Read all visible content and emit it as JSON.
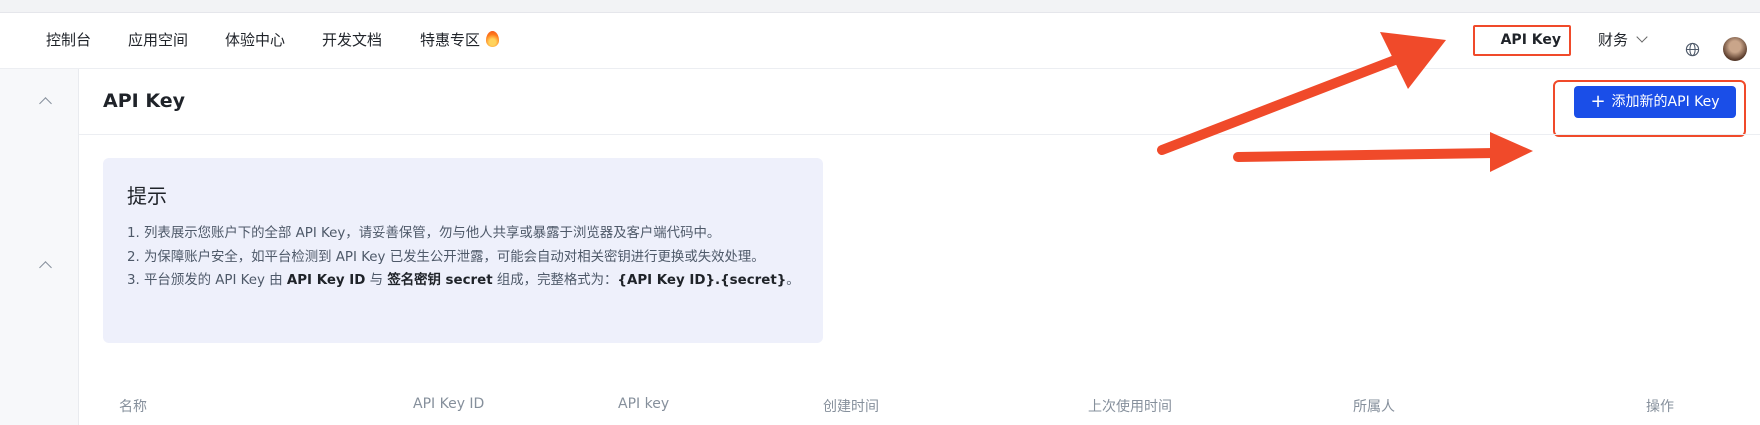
{
  "nav": {
    "items": [
      "控制台",
      "应用空间",
      "体验中心",
      "开发文档",
      "特惠专区"
    ],
    "apikey": "API Key",
    "finance": "财务"
  },
  "page": {
    "title": "API Key",
    "add_button": "添加新的API Key"
  },
  "tip": {
    "title": "提示",
    "line1": "1. 列表展示您账户下的全部 API Key，请妥善保管，勿与他人共享或暴露于浏览器及客户端代码中。",
    "line2": "2. 为保障账户安全，如平台检测到 API Key 已发生公开泄露，可能会自动对相关密钥进行更换或失效处理。",
    "line3_pre": "3. 平台颁发的 API Key 由 ",
    "line3_b1": "API Key ID",
    "line3_mid1": " 与 ",
    "line3_b2": "签名密钥 secret",
    "line3_mid2": " 组成，完整格式为：",
    "line3_b3": "{API Key ID}.{secret}",
    "line3_end": "。"
  },
  "table": {
    "headers": [
      "名称",
      "API Key ID",
      "API key",
      "创建时间",
      "上次使用时间",
      "所属人",
      "操作"
    ]
  },
  "colors": {
    "accent": "#1a4ee8",
    "annotation": "#f04a2a"
  }
}
